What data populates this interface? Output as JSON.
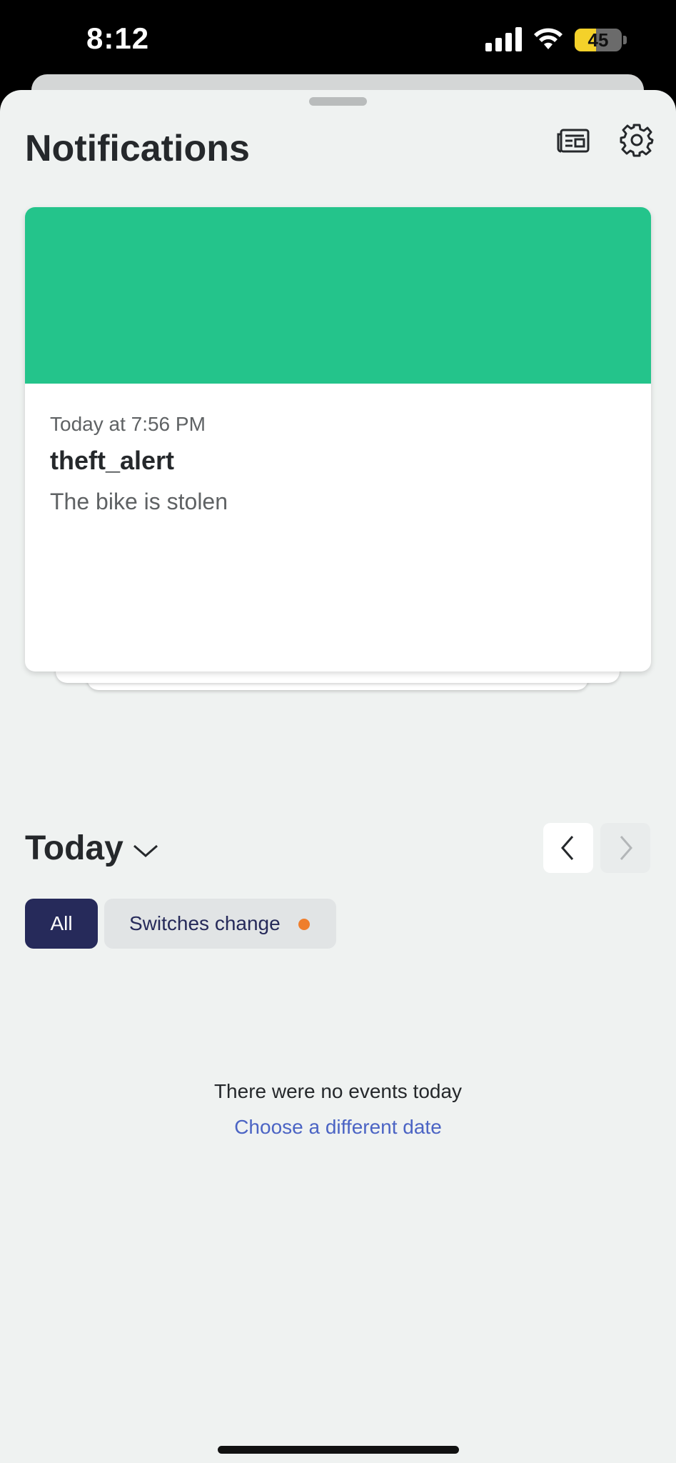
{
  "status_bar": {
    "time": "8:12",
    "battery_level": "45",
    "battery_fraction": 0.45
  },
  "header": {
    "title": "Notifications",
    "news_icon": "news-icon",
    "settings_icon": "gear-icon"
  },
  "notification_card": {
    "banner_color": "#24c48b",
    "time": "Today at 7:56 PM",
    "title": "theft_alert",
    "body": "The bike is stolen"
  },
  "date_selector": {
    "label": "Today",
    "dropdown_icon": "chevron-down-icon",
    "prev_icon": "chevron-left-icon",
    "next_icon": "chevron-right-icon"
  },
  "filters": [
    {
      "label": "All",
      "selected": true
    },
    {
      "label": "Switches change",
      "selected": false,
      "badge_color": "#ef7e2c"
    }
  ],
  "empty_state": {
    "message": "There were no events today",
    "link": "Choose a different date"
  }
}
